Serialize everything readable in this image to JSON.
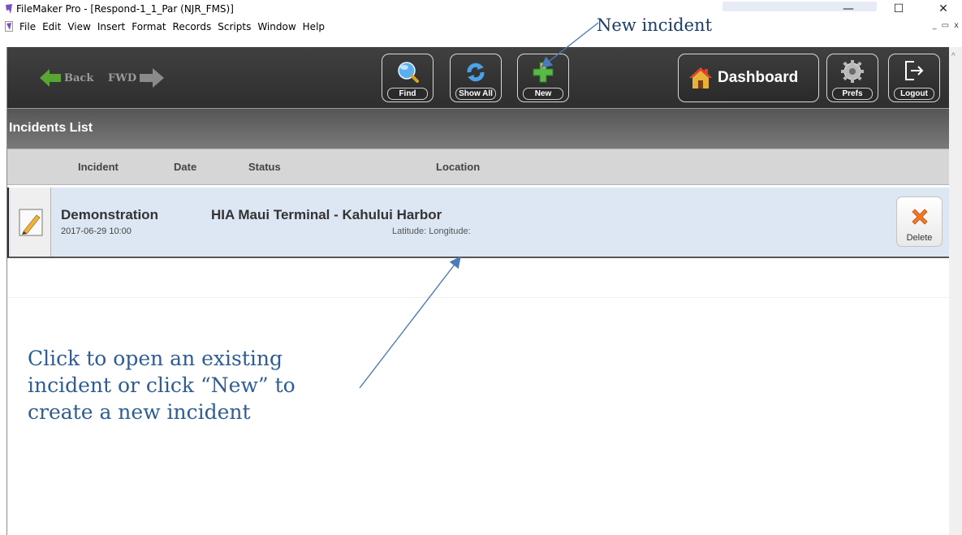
{
  "window": {
    "title": "FileMaker Pro - [Respond-1_1_Par (NJR_FMS)]",
    "min_glyph": "—",
    "max_glyph": "☐",
    "close_glyph": "✕",
    "mdi_min": "_",
    "mdi_restore": "▭",
    "mdi_close": "x"
  },
  "menubar": {
    "items": [
      "File",
      "Edit",
      "View",
      "Insert",
      "Format",
      "Records",
      "Scripts",
      "Window",
      "Help"
    ]
  },
  "toolbar": {
    "back_label": "Back",
    "fwd_label": "FWD",
    "find_label": "Find",
    "show_all_label": "Show All",
    "new_label": "New",
    "dashboard_label": "Dashboard",
    "prefs_label": "Prefs",
    "logout_label": "Logout"
  },
  "layout": {
    "title": "Incidents List"
  },
  "columns": {
    "incident": "Incident",
    "date": "Date",
    "status": "Status",
    "location": "Location"
  },
  "incidents": [
    {
      "name": "Demonstration",
      "datetime": "2017-06-29 10:00",
      "location": "HIA Maui Terminal - Kahului Harbor",
      "coords": "Latitude:  Longitude:",
      "delete_label": "Delete"
    }
  ],
  "annotations": {
    "new_callout": "New incident",
    "main_line1": "Click to open an existing",
    "main_line2": "incident or click “New” to",
    "main_line3": "create a new incident"
  },
  "colors": {
    "toolbar_bg": "#333333",
    "row_bg": "#dde6f3",
    "annotation": "#2e5d94",
    "arrow": "#4a7ab8",
    "new_icon": "#58b947",
    "delete_icon": "#f07a24"
  },
  "icons": {
    "app": "filemaker-app-icon",
    "back": "green-arrow-left-icon",
    "fwd": "gray-arrow-right-icon",
    "find": "magnifier-icon",
    "show_all": "refresh-icon",
    "new": "green-plus-icon",
    "dashboard": "house-icon",
    "prefs": "gear-icon",
    "logout": "logout-icon",
    "edit": "pencil-icon",
    "delete": "x-icon"
  }
}
